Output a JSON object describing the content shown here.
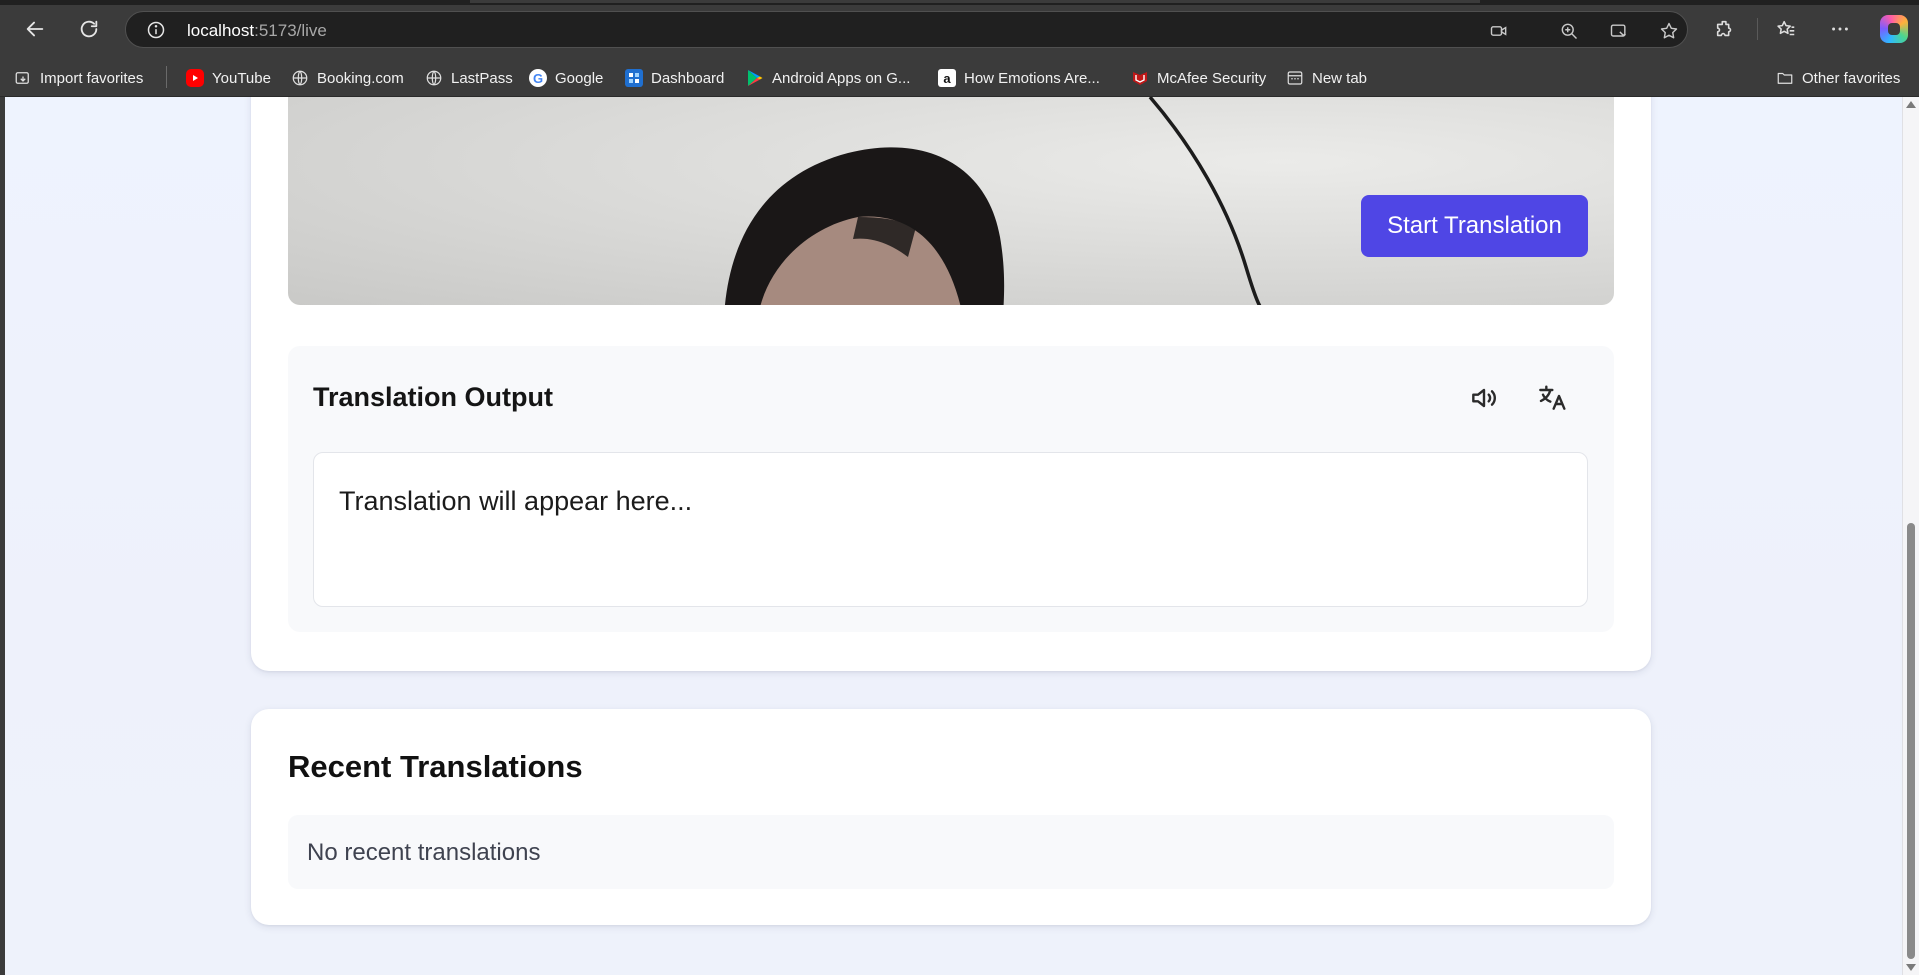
{
  "browser": {
    "url_host": "localhost",
    "url_path": ":5173/live"
  },
  "favorites": [
    {
      "label": "Import favorites",
      "icon": "import-icon"
    },
    {
      "label": "YouTube",
      "icon": "youtube-icon",
      "color": "#ff0000"
    },
    {
      "label": "Booking.com",
      "icon": "globe-icon"
    },
    {
      "label": "LastPass",
      "icon": "globe-icon"
    },
    {
      "label": "Google",
      "icon": "google-icon"
    },
    {
      "label": "Dashboard",
      "icon": "dashboard-icon"
    },
    {
      "label": "Android Apps on G...",
      "icon": "play-store-icon"
    },
    {
      "label": "How Emotions Are...",
      "icon": "amazon-icon"
    },
    {
      "label": "McAfee Security",
      "icon": "mcafee-icon",
      "color": "#c01818"
    },
    {
      "label": "New tab",
      "icon": "new-tab-icon"
    },
    {
      "label": "Other favorites",
      "icon": "folder-icon"
    }
  ],
  "video": {
    "start_button_label": "Start Translation",
    "accent_color": "#4f46e5"
  },
  "output": {
    "title": "Translation Output",
    "placeholder": "Translation will appear here...",
    "speak_icon": "speaker-icon",
    "translate_icon": "translate-icon"
  },
  "recent": {
    "title": "Recent Translations",
    "empty_text": "No recent translations"
  }
}
